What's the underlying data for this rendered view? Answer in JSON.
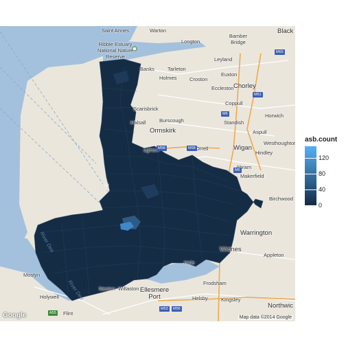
{
  "map": {
    "place_labels": [
      {
        "name": "Saint Annes",
        "style": "plain"
      },
      {
        "name": "Warton",
        "style": "plain"
      },
      {
        "name": "Bamber Bridge",
        "style": "plain"
      },
      {
        "name": "Black",
        "style": "big"
      },
      {
        "name": "Ribble Estuary National Nature Reserve",
        "style": "plain"
      },
      {
        "name": "Longton",
        "style": "plain"
      },
      {
        "name": "Leyland",
        "style": "plain"
      },
      {
        "name": "Banks",
        "style": "plain"
      },
      {
        "name": "Tarleton",
        "style": "plain"
      },
      {
        "name": "Euxton",
        "style": "plain"
      },
      {
        "name": "Holmes",
        "style": "plain"
      },
      {
        "name": "Croston",
        "style": "plain"
      },
      {
        "name": "Eccleston",
        "style": "plain"
      },
      {
        "name": "Chorley",
        "style": "big"
      },
      {
        "name": "Coppull",
        "style": "plain"
      },
      {
        "name": "Horwich",
        "style": "plain"
      },
      {
        "name": "Scarisbrick",
        "style": "plain"
      },
      {
        "name": "Burscough",
        "style": "plain"
      },
      {
        "name": "Standish",
        "style": "plain"
      },
      {
        "name": "Halsall",
        "style": "plain"
      },
      {
        "name": "Ormskirk",
        "style": "big"
      },
      {
        "name": "Aspull",
        "style": "plain"
      },
      {
        "name": "Westhoughton",
        "style": "plain"
      },
      {
        "name": "ughton",
        "style": "plain"
      },
      {
        "name": "Orrell",
        "style": "plain"
      },
      {
        "name": "Wigan",
        "style": "big"
      },
      {
        "name": "Hindley",
        "style": "plain"
      },
      {
        "name": "Abram",
        "style": "plain"
      },
      {
        "name": "Makerfield",
        "style": "plain"
      },
      {
        "name": "Birchwood",
        "style": "plain"
      },
      {
        "name": "Warrington",
        "style": "big"
      },
      {
        "name": "Widnes",
        "style": "big"
      },
      {
        "name": "Hale",
        "style": "plain"
      },
      {
        "name": "Appleton",
        "style": "plain"
      },
      {
        "name": "Mostyn",
        "style": "plain"
      },
      {
        "name": "Neston",
        "style": "plain"
      },
      {
        "name": "Willaston",
        "style": "plain"
      },
      {
        "name": "Ellesmere Port",
        "style": "big"
      },
      {
        "name": "Frodsham",
        "style": "plain"
      },
      {
        "name": "Helsby",
        "style": "plain"
      },
      {
        "name": "Kingsley",
        "style": "plain"
      },
      {
        "name": "Northwic",
        "style": "big"
      },
      {
        "name": "Holywell",
        "style": "plain"
      },
      {
        "name": "Flint",
        "style": "plain"
      },
      {
        "name": "Wi",
        "style": "light"
      },
      {
        "name": "River Dee",
        "style": "water"
      },
      {
        "name": "River Dee",
        "style": "water"
      }
    ],
    "road_shields": [
      {
        "name": "M65",
        "color": "#3c5fb0"
      },
      {
        "name": "M61",
        "color": "#3c5fb0"
      },
      {
        "name": "M6",
        "color": "#3c5fb0"
      },
      {
        "name": "M58",
        "color": "#3c5fb0"
      },
      {
        "name": "M58",
        "color": "#3c5fb0"
      },
      {
        "name": "M6",
        "color": "#3c5fb0"
      },
      {
        "name": "M53",
        "color": "#3c5fb0"
      },
      {
        "name": "M56",
        "color": "#3c5fb0"
      },
      {
        "name": "A55",
        "color": "#3a8a3a"
      }
    ],
    "google_logo": "Google",
    "credit": "Map data ©2014 Google",
    "fill_low_color": "#132b43",
    "fill_high_color": "#56b1f7",
    "sea_color": "#a3c1dd",
    "land_color": "#eae6dc"
  },
  "legend": {
    "title": "asb.count",
    "min": 0,
    "max": 150,
    "breaks": [
      {
        "label": "120",
        "value": 120
      },
      {
        "label": "80",
        "value": 80
      },
      {
        "label": "40",
        "value": 40
      },
      {
        "label": "0",
        "value": 0
      }
    ],
    "low_color": "#132b43",
    "high_color": "#56b1f7"
  }
}
